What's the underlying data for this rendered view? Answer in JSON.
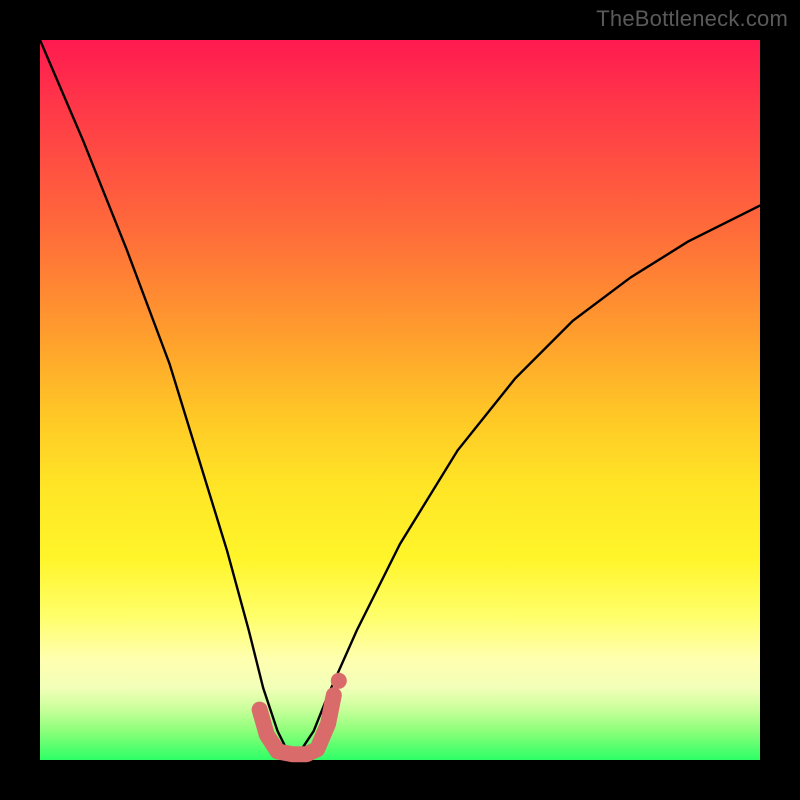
{
  "watermark": {
    "text": "TheBottleneck.com"
  },
  "chart_data": {
    "type": "line",
    "title": "",
    "xlabel": "",
    "ylabel": "",
    "xlim": [
      0,
      100
    ],
    "ylim": [
      0,
      100
    ],
    "grid": false,
    "legend": false,
    "series": [
      {
        "name": "bottleneck-curve",
        "x": [
          0,
          6,
          12,
          18,
          22,
          26,
          29,
          31,
          33,
          34.5,
          36,
          38,
          40,
          44,
          50,
          58,
          66,
          74,
          82,
          90,
          100
        ],
        "values": [
          100,
          86,
          71,
          55,
          42,
          29,
          18,
          10,
          4,
          1,
          1,
          4,
          9,
          18,
          30,
          43,
          53,
          61,
          67,
          72,
          77
        ],
        "color": "#000000"
      },
      {
        "name": "optimal-range-marker",
        "x": [
          30.5,
          31.5,
          33,
          35,
          37,
          38.5,
          40,
          40.8
        ],
        "values": [
          7,
          3.5,
          1.2,
          0.8,
          0.8,
          1.5,
          5,
          9
        ],
        "color": "#d96b6b"
      }
    ],
    "markers": [
      {
        "name": "optimal-dot",
        "x": 41.5,
        "y": 11,
        "color": "#d96b6b"
      }
    ],
    "background_gradient": {
      "direction": "top-to-bottom",
      "stops": [
        {
          "pos": 0,
          "color": "#ff1a50"
        },
        {
          "pos": 26,
          "color": "#ff6a3a"
        },
        {
          "pos": 52,
          "color": "#ffc726"
        },
        {
          "pos": 72,
          "color": "#fff52a"
        },
        {
          "pos": 90,
          "color": "#f2ffb8"
        },
        {
          "pos": 100,
          "color": "#2dff66"
        }
      ]
    }
  }
}
